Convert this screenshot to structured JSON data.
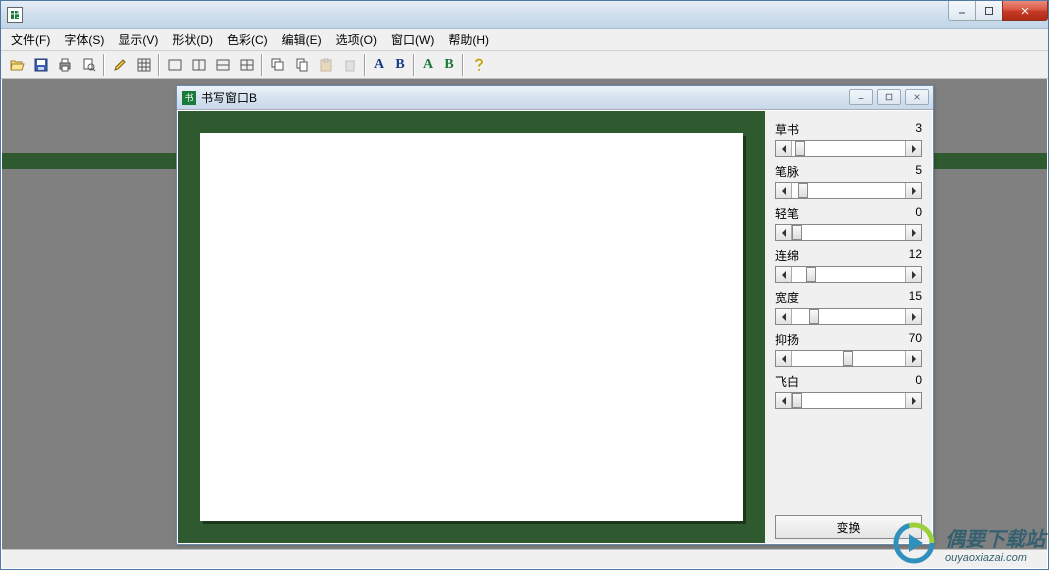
{
  "app": {
    "title": ""
  },
  "menu": {
    "file": "文件(F)",
    "font": "字体(S)",
    "display": "显示(V)",
    "shape": "形状(D)",
    "color": "色彩(C)",
    "edit": "编辑(E)",
    "options": "选项(O)",
    "window": "窗口(W)",
    "help": "帮助(H)"
  },
  "toolbar": {
    "ab1_a": "A",
    "ab1_b": "B",
    "ab2_a": "A",
    "ab2_b": "B"
  },
  "child": {
    "title": "书写窗口B"
  },
  "sliders": [
    {
      "label": "草书",
      "value": 3,
      "pos": 3
    },
    {
      "label": "笔脉",
      "value": 5,
      "pos": 5
    },
    {
      "label": "轻笔",
      "value": 0,
      "pos": 0
    },
    {
      "label": "连绵",
      "value": 12,
      "pos": 12
    },
    {
      "label": "宽度",
      "value": 15,
      "pos": 15
    },
    {
      "label": "抑扬",
      "value": 70,
      "pos": 45
    },
    {
      "label": "飞白",
      "value": 0,
      "pos": 0
    }
  ],
  "actions": {
    "transform": "变换"
  },
  "watermark": {
    "cn": "偶要下载站",
    "en": "ouyaoxiazai.com"
  }
}
